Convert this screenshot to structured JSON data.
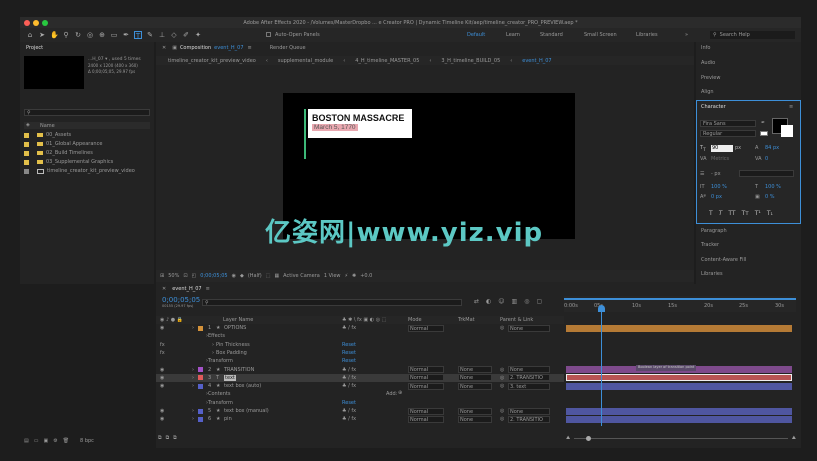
{
  "window": {
    "title": "Adobe After Effects 2020 - /Volumes/MasterDropbo ... e Creator PRO | Dynamic Timeline Kit/aep/timeline_creator_PRO_PREVIEW.aep *"
  },
  "toolbar": {
    "auto_open_panels": "Auto-Open Panels",
    "workspaces": [
      "Default",
      "Learn",
      "Standard",
      "Small Screen",
      "Libraries"
    ],
    "search_placeholder": "Search Help"
  },
  "project": {
    "tab": "Project",
    "item_info": "...H_07 ▾ , used 5 times",
    "item_dims": "2400 x 1200  (400 x 360)",
    "item_dur": "Δ 0;00;05;05, 29.97 fps",
    "search_placeholder": "",
    "col_name": "Name",
    "items": [
      {
        "name": "00_Assets",
        "type": "folder"
      },
      {
        "name": "01_Global Appearance",
        "type": "folder"
      },
      {
        "name": "02_Build Timelines",
        "type": "folder"
      },
      {
        "name": "03_Supplemental Graphics",
        "type": "folder"
      },
      {
        "name": "timeline_creator_kit_preview_video",
        "type": "comp"
      }
    ],
    "bpc": "8 bpc"
  },
  "comp": {
    "tab": "Composition",
    "tab_name": "event_H_07",
    "render_queue": "Render Queue",
    "breadcrumbs": [
      "timeline_creator_kit_preview_video",
      "supplemental_module",
      "4_H_timeline_MASTER_05",
      "3_H_timeline_BUILD_05",
      "event_H_07"
    ],
    "card_title": "BOSTON MASSACRE",
    "card_date": "March 5, 1770",
    "footer": {
      "zoom": "50%",
      "timecode": "0;00;05;05",
      "quality": "(Half)",
      "camera": "Active Camera",
      "view": "1 View",
      "exposure": "+0.0"
    }
  },
  "watermark": "亿姿网|www.yiz.vip",
  "right": {
    "panels": [
      "Info",
      "Audio",
      "Preview",
      "Align"
    ],
    "character": {
      "title": "Character",
      "font": "Fira Sans",
      "style": "Regular",
      "size": "90",
      "size_unit": "px",
      "leading": "84 px",
      "kerning": "Metrics",
      "tracking": "0",
      "stroke": "- px",
      "vscale": "100 %",
      "hscale": "100 %",
      "baseline": "0 px",
      "tsume": "0 %"
    },
    "panels_bottom": [
      "Paragraph",
      "Tracker",
      "Content-Aware Fill",
      "Libraries"
    ]
  },
  "timeline": {
    "tab": "event_H_07",
    "timecode": "0;00;05;05",
    "timecode_sub": "00155 (29.97 fps)",
    "headers": {
      "layer_name": "Layer Name",
      "mode": "Mode",
      "trkmat": "TrkMat",
      "parent": "Parent & Link"
    },
    "ruler": [
      "0:00s",
      "05s",
      "10s",
      "15s",
      "20s",
      "25s",
      "30s"
    ],
    "rows": [
      {
        "kind": "layer",
        "num": "1",
        "name": "OPTIONS",
        "color": "#d4923a",
        "mode": "Normal",
        "trk": "",
        "parent": "None"
      },
      {
        "kind": "group",
        "name": "Effects"
      },
      {
        "kind": "fx",
        "name": "Pin Thickness",
        "reset": "Reset"
      },
      {
        "kind": "fx",
        "name": "Box Padding",
        "reset": "Reset"
      },
      {
        "kind": "group",
        "name": "Transform",
        "reset": "Reset"
      },
      {
        "kind": "layer",
        "num": "2",
        "name": "TRANSITION",
        "color": "#a452c8",
        "mode": "Normal",
        "trk": "None",
        "parent": "None"
      },
      {
        "kind": "layer",
        "num": "3",
        "name": "text",
        "color": "#e05a5a",
        "mode": "Normal",
        "trk": "None",
        "parent": "2. TRANSITIO",
        "selected": true
      },
      {
        "kind": "layer",
        "num": "4",
        "name": "text box (auto)",
        "color": "#5560c8",
        "mode": "Normal",
        "trk": "None",
        "parent": "3. text"
      },
      {
        "kind": "group",
        "name": "Contents",
        "add": "Add:"
      },
      {
        "kind": "group",
        "name": "Transform",
        "reset": "Reset"
      },
      {
        "kind": "layer",
        "num": "5",
        "name": "text box (manual)",
        "color": "#5560c8",
        "mode": "Normal",
        "trk": "None",
        "parent": "None"
      },
      {
        "kind": "layer",
        "num": "6",
        "name": "pin",
        "color": "#5560c8",
        "mode": "Normal",
        "trk": "None",
        "parent": "2. TRANSITIO"
      }
    ],
    "track_label": "Boolean layer of transition point"
  }
}
